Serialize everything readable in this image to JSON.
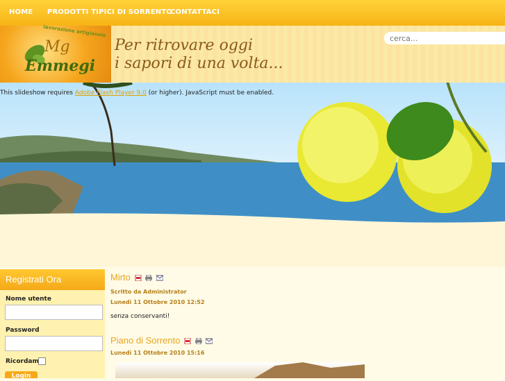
{
  "nav": {
    "items": [
      "HOME",
      "PRODOTTI TIPICI DI SORRENTO",
      "CONTATTACI"
    ]
  },
  "header": {
    "logo_name": "Emmegi",
    "logo_mg": "Mg",
    "logo_arc": "lavorazione artigianale",
    "tagline_line1": "Per ritrovare oggi",
    "tagline_line2": "i sapori di una volta...",
    "search_placeholder": "cerca..."
  },
  "banner": {
    "notice_prefix": "This slideshow requires ",
    "notice_link": "Adobe Flash Player 9.0",
    "notice_suffix": " (or higher). JavaScript must be enabled."
  },
  "sidebar": {
    "title": "Registrati Ora",
    "username_label": "Nome utente",
    "password_label": "Password",
    "remember_label": "Ricordami",
    "login_label": "Login"
  },
  "articles": [
    {
      "title": "Mirto",
      "author": "Scritto da Administrator",
      "date": "Lunedì 11 Ottobre 2010 12:52",
      "body": "senza conservanti!"
    },
    {
      "title": "Piano di Sorrento",
      "date": "Lunedì 11 Ottobre 2010 15:16"
    }
  ],
  "colors": {
    "accent": "#f6a818",
    "title": "#e8a522",
    "meta": "#b57f1a"
  },
  "icons": [
    "pdf-icon",
    "print-icon",
    "email-icon"
  ]
}
